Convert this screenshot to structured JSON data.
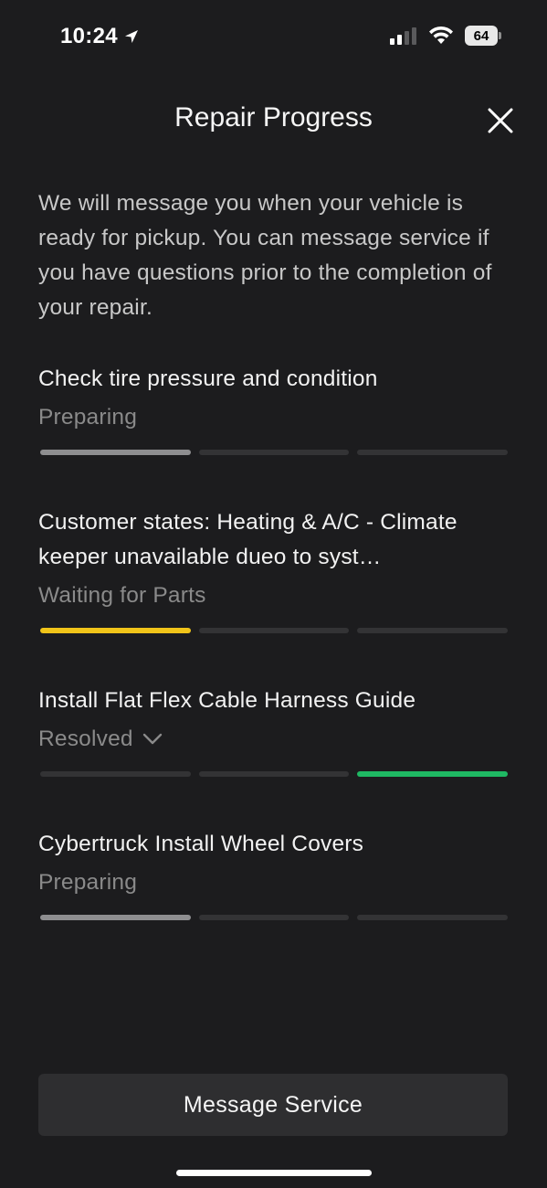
{
  "status_bar": {
    "time": "10:24",
    "battery": "64"
  },
  "header": {
    "title": "Repair Progress"
  },
  "intro": {
    "text": "We will message you when your vehicle is ready for pickup. You can message service if you have questions prior to the completion of your repair."
  },
  "items": [
    {
      "title": "Check tire pressure and condition",
      "status": "Preparing",
      "progress_step": 1,
      "progress_color": "#8e8e90"
    },
    {
      "title": "Customer states: Heating & A/C - Climate keeper unavailable dueo to syst…",
      "status": "Waiting for Parts",
      "progress_step": 1,
      "progress_color": "#f0c419"
    },
    {
      "title": "Install Flat Flex Cable Harness Guide",
      "status": "Resolved",
      "progress_step": 3,
      "progress_color": "#1fb863"
    },
    {
      "title": "Cybertruck Install Wheel Covers",
      "status": "Preparing",
      "progress_step": 1,
      "progress_color": "#8e8e90"
    }
  ],
  "footer": {
    "message_button": "Message Service"
  },
  "colors": {
    "background": "#1c1c1e",
    "segment_inactive": "#333335",
    "button_bg": "#2e2e30"
  }
}
